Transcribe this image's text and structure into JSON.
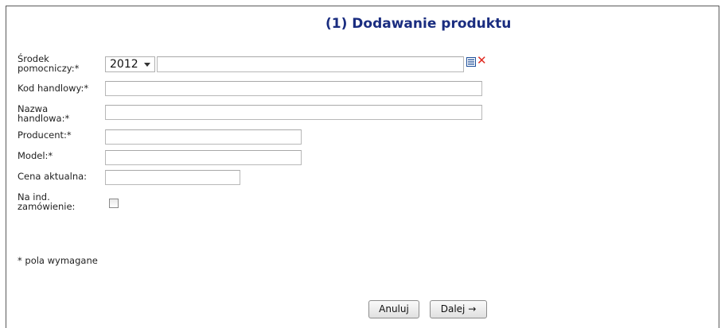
{
  "form": {
    "title": "(1) Dodawanie produktu",
    "fields": {
      "srodek": {
        "label_line1": "Środek",
        "label_line2": "pomocniczy:*",
        "year_value": "2012",
        "value": ""
      },
      "kod_handlowy": {
        "label": "Kod handlowy:*",
        "value": ""
      },
      "nazwa_handlowa": {
        "label_line1": "Nazwa",
        "label_line2": "handlowa:*",
        "value": ""
      },
      "producent": {
        "label": "Producent:*",
        "value": ""
      },
      "model": {
        "label": "Model:*",
        "value": ""
      },
      "cena_aktualna": {
        "label": "Cena aktualna:",
        "value": ""
      },
      "na_ind_zamowienie": {
        "label_line1": "Na ind.",
        "label_line2": "zamówienie:",
        "checked": false
      }
    },
    "required_note": "* pola wymagane",
    "buttons": {
      "cancel_label": "Anuluj",
      "next_label": "Dalej →"
    },
    "icons": {
      "list": "list-icon",
      "clear": "clear-icon"
    },
    "colors": {
      "title": "#1a2d80",
      "clear_icon": "#e0281e"
    }
  }
}
